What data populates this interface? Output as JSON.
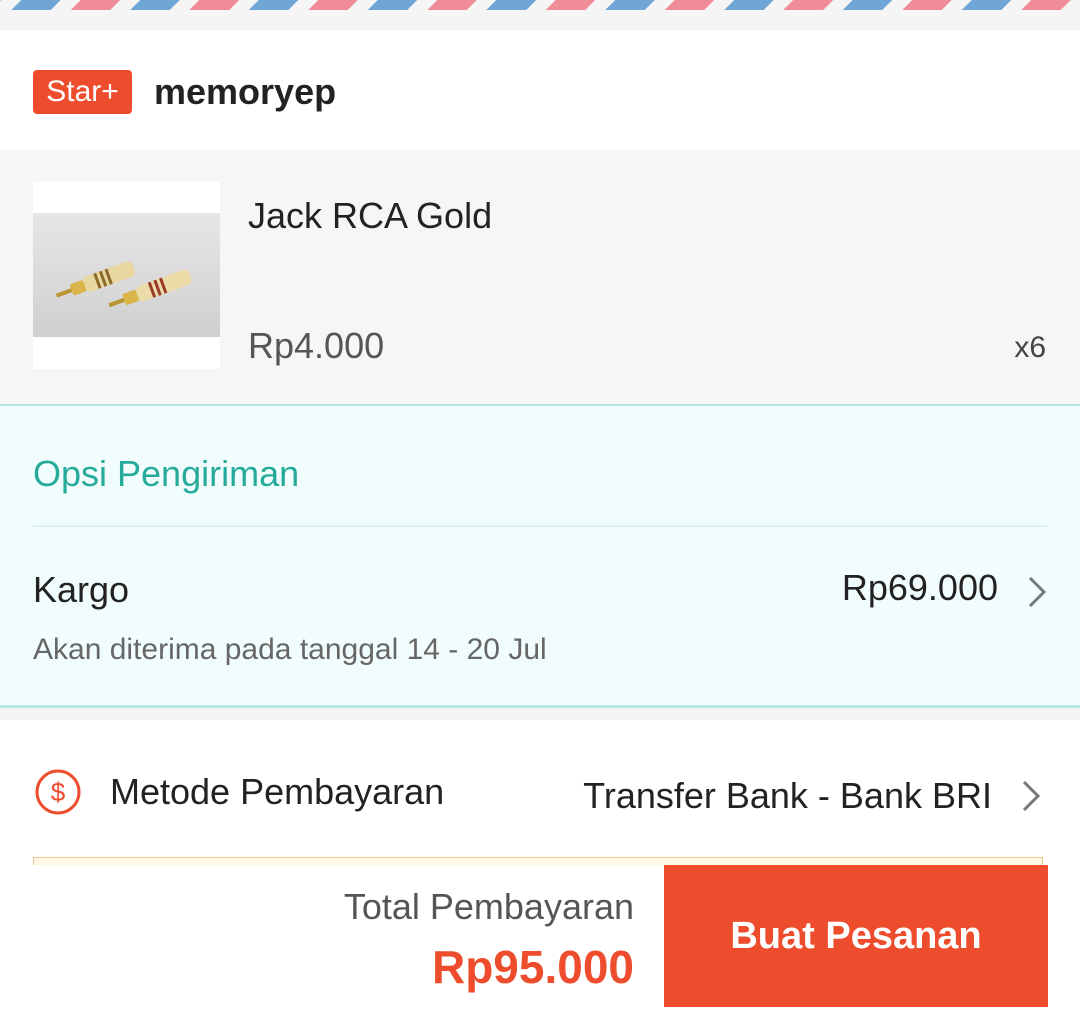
{
  "shop": {
    "badge": "Star+",
    "name": "memoryep"
  },
  "product": {
    "name": "Jack RCA Gold",
    "price": "Rp4.000",
    "quantity": "x6",
    "image_icon": "rca-jack-photo"
  },
  "shipping": {
    "title": "Opsi Pengiriman",
    "courier": "Kargo",
    "cost": "Rp69.000",
    "eta": "Akan diterima pada tanggal 14 - 20 Jul"
  },
  "payment": {
    "label": "Metode Pembayaran",
    "method": "Transfer Bank - Bank BRI",
    "icon": "dollar-circle-icon"
  },
  "footer": {
    "total_label": "Total Pembayaran",
    "total_amount": "Rp95.000",
    "order_button": "Buat Pesanan"
  },
  "colors": {
    "brand": "#ee4d2d",
    "shipping_accent": "#26aa99",
    "shipping_bg": "#f1fdfd",
    "airmail_blue": "#6fa6d6",
    "airmail_red": "#f08c98"
  }
}
